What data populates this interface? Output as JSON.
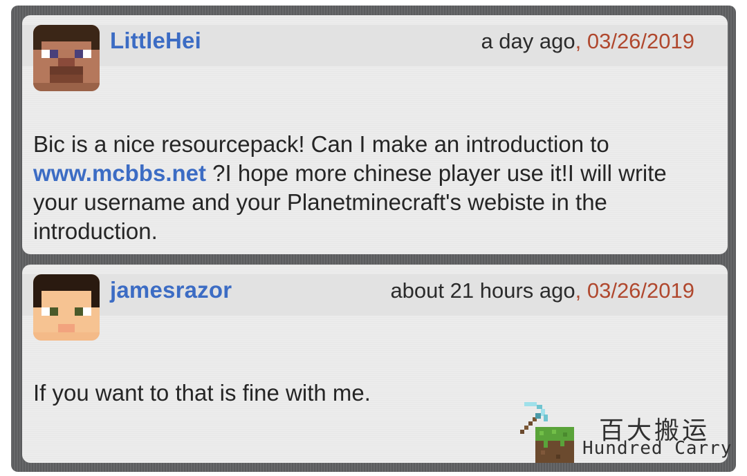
{
  "comments": [
    {
      "username": "LittleHei",
      "relative_time": "a day ago",
      "separator": ", ",
      "date": "03/26/2019",
      "avatar_icon": "steve-head-icon",
      "body_before_link": "Bic is a nice resourcepack! Can I make an introduction to ",
      "link_text": "www.mcbbs.net",
      "body_after_link": " ?I hope more chinese player use it!I will write your username and your Planetminecraft's webiste in the introduction."
    },
    {
      "username": "jamesrazor",
      "relative_time": "about 21 hours ago",
      "separator": ", ",
      "date": "03/26/2019",
      "avatar_icon": "pixel-face-icon",
      "body": "If you want to that is fine with me."
    }
  ],
  "watermark": {
    "chinese": "百大搬运",
    "english": "Hundred Carry",
    "icon": "pickaxe-grass-block-icon"
  },
  "colors": {
    "username": "#3c6cc4",
    "date": "#b0482e",
    "link": "#3c6cc4",
    "frame": "#5f6062",
    "card": "#ececec"
  }
}
